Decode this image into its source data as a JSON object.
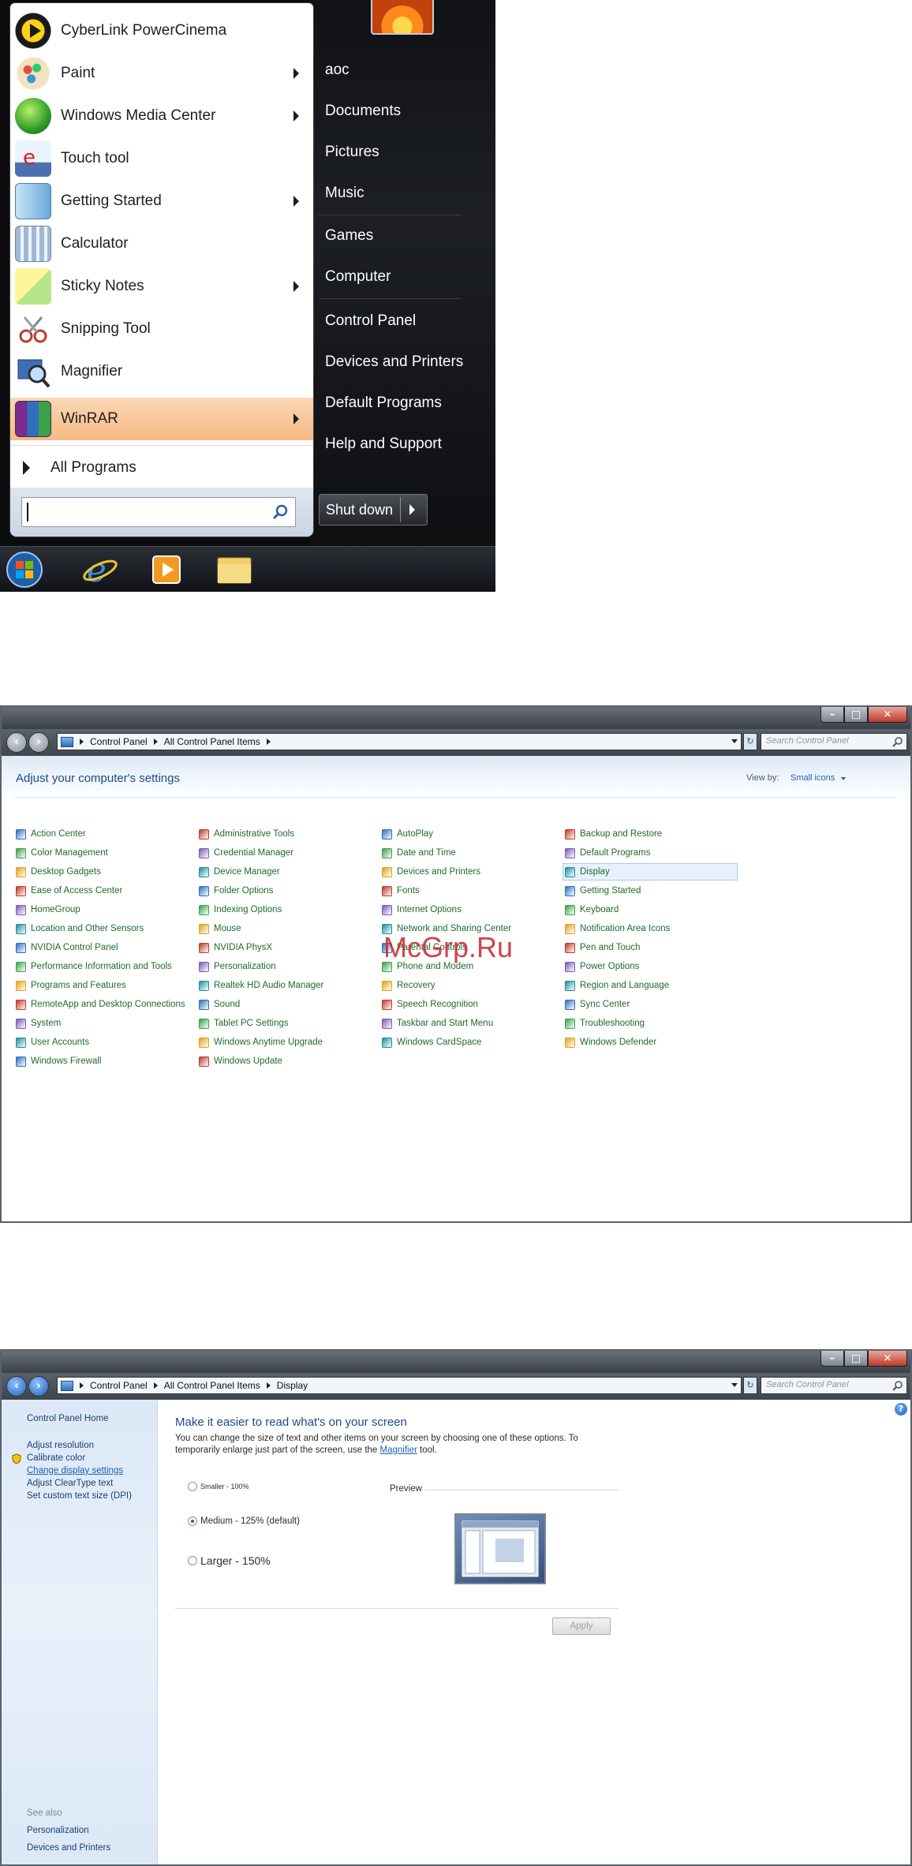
{
  "start_menu": {
    "programs": [
      {
        "label": "CyberLink PowerCinema",
        "icon": "powercinema-icon",
        "has_arrow": false
      },
      {
        "label": "Paint",
        "icon": "paint-icon",
        "has_arrow": true
      },
      {
        "label": "Windows Media Center",
        "icon": "media-center-icon",
        "has_arrow": true
      },
      {
        "label": "Touch tool",
        "icon": "touch-tool-icon",
        "has_arrow": false
      },
      {
        "label": "Getting Started",
        "icon": "getting-started-icon",
        "has_arrow": true
      },
      {
        "label": "Calculator",
        "icon": "calculator-icon",
        "has_arrow": false
      },
      {
        "label": "Sticky Notes",
        "icon": "sticky-notes-icon",
        "has_arrow": true
      },
      {
        "label": "Snipping Tool",
        "icon": "snipping-tool-icon",
        "has_arrow": false
      },
      {
        "label": "Magnifier",
        "icon": "magnifier-icon",
        "has_arrow": false
      },
      {
        "label": "WinRAR",
        "icon": "winrar-icon",
        "has_arrow": true,
        "highlighted": true
      }
    ],
    "all_programs": "All Programs",
    "search_value": "",
    "right_links": [
      "aoc",
      "Documents",
      "Pictures",
      "Music",
      "Games",
      "Computer",
      "Control Panel",
      "Devices and Printers",
      "Default Programs",
      "Help and Support"
    ],
    "shutdown_label": "Shut down",
    "taskbar_icons": [
      "start-orb-icon",
      "internet-explorer-icon",
      "media-player-icon",
      "explorer-folder-icon"
    ]
  },
  "control_panel": {
    "breadcrumb": [
      "Control Panel",
      "All Control Panel Items"
    ],
    "search_placeholder": "Search Control Panel",
    "title": "Adjust your computer's settings",
    "view_by_label": "View by:",
    "view_by_value": "Small icons",
    "columns": [
      [
        "Action Center",
        "Color Management",
        "Desktop Gadgets",
        "Ease of Access Center",
        "HomeGroup",
        "Location and Other Sensors",
        "NVIDIA Control Panel",
        "Performance Information and Tools",
        "Programs and Features",
        "RemoteApp and Desktop Connections",
        "System",
        "User Accounts",
        "Windows Firewall"
      ],
      [
        "Administrative Tools",
        "Credential Manager",
        "Device Manager",
        "Folder Options",
        "Indexing Options",
        "Mouse",
        "NVIDIA PhysX",
        "Personalization",
        "Realtek HD Audio Manager",
        "Sound",
        "Tablet PC Settings",
        "Windows Anytime Upgrade",
        "Windows Update"
      ],
      [
        "AutoPlay",
        "Date and Time",
        "Devices and Printers",
        "Fonts",
        "Internet Options",
        "Network and Sharing Center",
        "Parental Controls",
        "Phone and Modem",
        "Recovery",
        "Speech Recognition",
        "Taskbar and Start Menu",
        "Windows CardSpace"
      ],
      [
        "Backup and Restore",
        "Default Programs",
        "Display",
        "Getting Started",
        "Keyboard",
        "Notification Area Icons",
        "Pen and Touch",
        "Power Options",
        "Region and Language",
        "Sync Center",
        "Troubleshooting",
        "Windows Defender"
      ]
    ],
    "selected_item": "Display",
    "watermark": "McGrp.Ru"
  },
  "display": {
    "breadcrumb": [
      "Control Panel",
      "All Control Panel Items",
      "Display"
    ],
    "search_placeholder": "Search Control Panel",
    "sidebar": {
      "home": "Control Panel Home",
      "links": [
        "Adjust resolution",
        "Calibrate color",
        "Change display settings",
        "Adjust ClearType text",
        "Set custom text size (DPI)"
      ],
      "see_also_label": "See also",
      "see_also": [
        "Personalization",
        "Devices and Printers"
      ]
    },
    "help_glyph": "?",
    "title": "Make it easier to read what's on your screen",
    "desc_before": "You can change the size of text and other items on your screen by choosing one of these options. To temporarily enlarge just part of the screen, use the ",
    "desc_link": "Magnifier",
    "desc_after": " tool.",
    "options": [
      {
        "label": "Smaller - 100%",
        "selected": false
      },
      {
        "label": "Medium - 125% (default)",
        "selected": true
      },
      {
        "label": "Larger - 150%",
        "selected": false
      }
    ],
    "preview_label": "Preview",
    "apply_label": "Apply"
  },
  "window_buttons": {
    "minimize": "–",
    "maximize": "□",
    "close": "✕"
  },
  "colors": {
    "link_green": "#1f6a2c",
    "link_blue": "#1d5fb6",
    "title_blue": "#1b4a8d",
    "highlight_orange": "#f6b984"
  }
}
